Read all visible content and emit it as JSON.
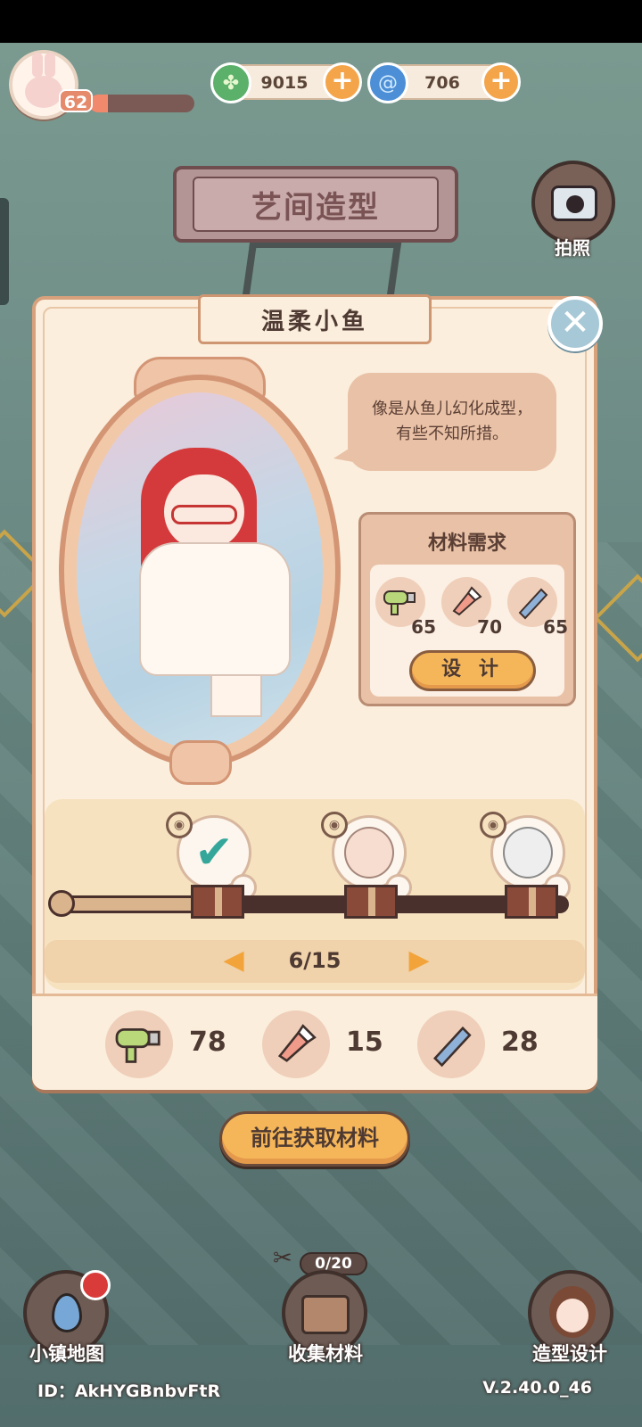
{
  "player": {
    "level": "62",
    "xp_fraction": 0.18
  },
  "currencies": [
    {
      "icon": "clover-icon",
      "value": "9015",
      "color": "#5bb06a"
    },
    {
      "icon": "swirl-icon",
      "value": "706",
      "color": "#4d8fd6"
    }
  ],
  "header": {
    "title": "艺间造型",
    "camera_label": "拍照"
  },
  "outfit": {
    "name": "温柔小鱼",
    "description": "像是从鱼儿幻化成型，有些不知所措。"
  },
  "materials_required": {
    "title": "材料需求",
    "items": [
      {
        "icon": "hair-dryer-icon",
        "count": "65"
      },
      {
        "icon": "makeup-brush-icon",
        "count": "70"
      },
      {
        "icon": "comb-icon",
        "count": "65"
      }
    ],
    "design_label": "设 计"
  },
  "progress": {
    "fill_fraction": 0.33,
    "milestones": [
      {
        "state": "completed",
        "icon": "checkmark-icon"
      },
      {
        "state": "locked",
        "icon": "bald-head-icon"
      },
      {
        "state": "locked",
        "icon": "white-hair-head-icon"
      }
    ],
    "page": "6/15"
  },
  "inventory": [
    {
      "icon": "hair-dryer-icon",
      "count": "78"
    },
    {
      "icon": "makeup-brush-icon",
      "count": "15"
    },
    {
      "icon": "comb-icon",
      "count": "28"
    }
  ],
  "get_materials_label": "前往获取材料",
  "bottom_nav": [
    {
      "icon": "map-pin-icon",
      "label": "小镇地图",
      "notification": true
    },
    {
      "icon": "toolbox-icon",
      "label": "收集材料",
      "counter": "0/20"
    },
    {
      "icon": "girl-avatar-icon",
      "label": "造型设计"
    }
  ],
  "footer": {
    "id": "ID：AkHYGBnbvFtR",
    "version": "V.2.40.0_46"
  }
}
